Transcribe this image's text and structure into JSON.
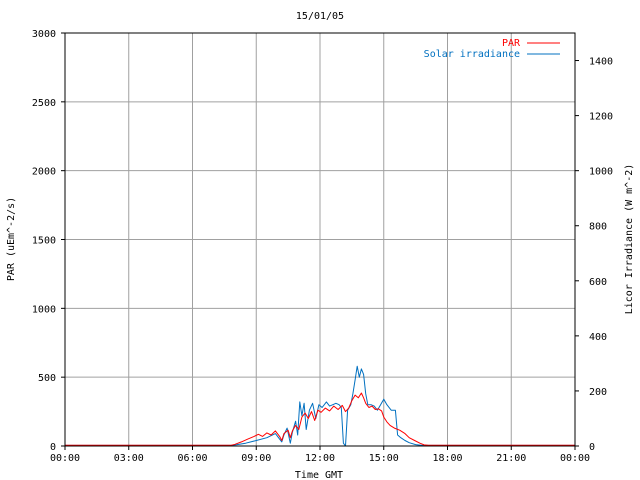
{
  "chart_data": {
    "type": "line",
    "title": "15/01/05",
    "xlabel": "Time GMT",
    "ylabel_left": "PAR (uEm^-2/s)",
    "ylabel_right": "Licor Irradiance (W m^-2)",
    "x_unit": "hours GMT",
    "xlim": [
      0,
      24
    ],
    "ylim_left": [
      0,
      3000
    ],
    "ylim_right": [
      0,
      1500
    ],
    "x_ticks": [
      0,
      3,
      6,
      9,
      12,
      15,
      18,
      21,
      24
    ],
    "x_tick_labels": [
      "00:00",
      "03:00",
      "06:00",
      "09:00",
      "12:00",
      "15:00",
      "18:00",
      "21:00",
      "00:00"
    ],
    "y_ticks_left": [
      0,
      500,
      1000,
      1500,
      2000,
      2500,
      3000
    ],
    "y_ticks_right": [
      0,
      200,
      400,
      600,
      800,
      1000,
      1200,
      1400
    ],
    "grid": true,
    "legend_position": "top-right",
    "series": [
      {
        "name": "PAR",
        "axis": "left",
        "color": "#ff0000",
        "points": [
          [
            0,
            5
          ],
          [
            7.8,
            5
          ],
          [
            8.0,
            12
          ],
          [
            8.3,
            30
          ],
          [
            8.6,
            50
          ],
          [
            8.9,
            70
          ],
          [
            9.1,
            85
          ],
          [
            9.3,
            70
          ],
          [
            9.5,
            95
          ],
          [
            9.7,
            80
          ],
          [
            9.9,
            110
          ],
          [
            10.1,
            70
          ],
          [
            10.2,
            40
          ],
          [
            10.3,
            90
          ],
          [
            10.5,
            115
          ],
          [
            10.6,
            60
          ],
          [
            10.7,
            110
          ],
          [
            10.85,
            150
          ],
          [
            11.0,
            120
          ],
          [
            11.15,
            210
          ],
          [
            11.3,
            240
          ],
          [
            11.45,
            200
          ],
          [
            11.6,
            250
          ],
          [
            11.75,
            185
          ],
          [
            11.9,
            260
          ],
          [
            12.05,
            245
          ],
          [
            12.25,
            275
          ],
          [
            12.45,
            255
          ],
          [
            12.65,
            290
          ],
          [
            12.85,
            265
          ],
          [
            13.05,
            295
          ],
          [
            13.2,
            250
          ],
          [
            13.35,
            275
          ],
          [
            13.5,
            330
          ],
          [
            13.65,
            370
          ],
          [
            13.8,
            350
          ],
          [
            13.95,
            385
          ],
          [
            14.05,
            350
          ],
          [
            14.15,
            310
          ],
          [
            14.3,
            280
          ],
          [
            14.45,
            290
          ],
          [
            14.6,
            265
          ],
          [
            14.75,
            270
          ],
          [
            14.9,
            255
          ],
          [
            15.0,
            210
          ],
          [
            15.15,
            175
          ],
          [
            15.3,
            150
          ],
          [
            15.5,
            130
          ],
          [
            15.75,
            115
          ],
          [
            16.0,
            90
          ],
          [
            16.2,
            60
          ],
          [
            16.45,
            40
          ],
          [
            16.7,
            20
          ],
          [
            16.9,
            8
          ],
          [
            17.1,
            5
          ],
          [
            24,
            5
          ]
        ]
      },
      {
        "name": "Solar irradiance",
        "axis": "right",
        "color": "#0070c0",
        "points": [
          [
            0,
            2
          ],
          [
            7.8,
            2
          ],
          [
            8.1,
            5
          ],
          [
            8.5,
            10
          ],
          [
            9.0,
            20
          ],
          [
            9.5,
            30
          ],
          [
            9.9,
            45
          ],
          [
            10.2,
            15
          ],
          [
            10.3,
            40
          ],
          [
            10.45,
            65
          ],
          [
            10.6,
            10
          ],
          [
            10.7,
            50
          ],
          [
            10.85,
            90
          ],
          [
            10.95,
            40
          ],
          [
            11.05,
            160
          ],
          [
            11.15,
            110
          ],
          [
            11.25,
            155
          ],
          [
            11.35,
            60
          ],
          [
            11.5,
            130
          ],
          [
            11.65,
            155
          ],
          [
            11.8,
            100
          ],
          [
            11.95,
            150
          ],
          [
            12.1,
            140
          ],
          [
            12.3,
            160
          ],
          [
            12.45,
            145
          ],
          [
            12.6,
            150
          ],
          [
            12.75,
            155
          ],
          [
            12.9,
            150
          ],
          [
            13.0,
            140
          ],
          [
            13.1,
            10
          ],
          [
            13.2,
            0
          ],
          [
            13.3,
            130
          ],
          [
            13.45,
            150
          ],
          [
            13.55,
            190
          ],
          [
            13.65,
            240
          ],
          [
            13.75,
            290
          ],
          [
            13.85,
            250
          ],
          [
            13.95,
            280
          ],
          [
            14.05,
            260
          ],
          [
            14.15,
            190
          ],
          [
            14.25,
            150
          ],
          [
            14.4,
            150
          ],
          [
            14.55,
            145
          ],
          [
            14.7,
            130
          ],
          [
            14.85,
            150
          ],
          [
            15.0,
            170
          ],
          [
            15.15,
            150
          ],
          [
            15.35,
            130
          ],
          [
            15.55,
            130
          ],
          [
            15.65,
            40
          ],
          [
            15.8,
            30
          ],
          [
            16.0,
            20
          ],
          [
            16.2,
            12
          ],
          [
            16.5,
            5
          ],
          [
            16.8,
            2
          ],
          [
            24,
            2
          ]
        ]
      }
    ]
  }
}
